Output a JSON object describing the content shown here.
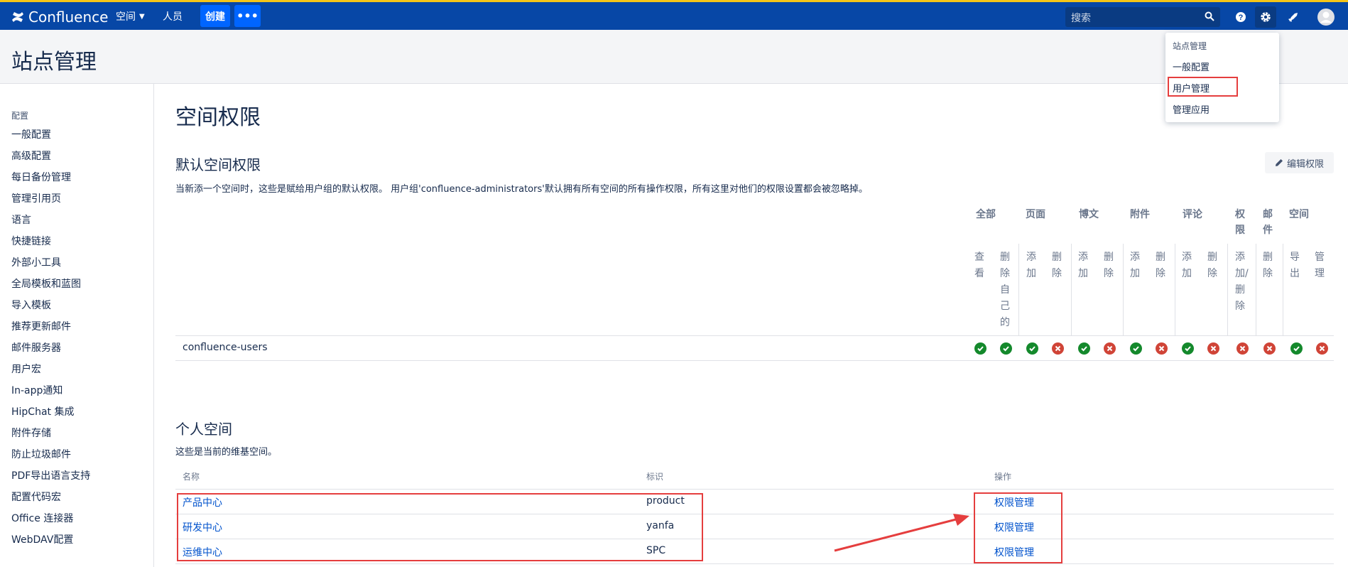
{
  "topbar": {
    "logo": "Confluence",
    "spaces": "空间",
    "people": "人员",
    "create": "创建",
    "more": "•••",
    "search_placeholder": "搜索",
    "icons": [
      "help-icon",
      "settings-icon",
      "notifications-icon",
      "avatar-icon"
    ]
  },
  "header": {
    "title": "站点管理"
  },
  "dropdown": {
    "heading": "站点管理",
    "items": [
      "一般配置",
      "用户管理",
      "管理应用"
    ]
  },
  "sidebar": {
    "heading": "配置",
    "items": [
      "一般配置",
      "高级配置",
      "每日备份管理",
      "管理引用页",
      "语言",
      "快捷链接",
      "外部小工具",
      "全局模板和蓝图",
      "导入模板",
      "推荐更新邮件",
      "邮件服务器",
      "用户宏",
      "In-app通知",
      "HipChat 集成",
      "附件存储",
      "防止垃圾邮件",
      "PDF导出语言支持",
      "配置代码宏",
      "Office 连接器",
      "WebDAV配置"
    ]
  },
  "main": {
    "title": "空间权限",
    "default_section": {
      "title": "默认空间权限",
      "description": "当新添一个空间时，这些是赋给用户组的默认权限。 用户组'confluence-administrators'默认拥有所有空间的所有操作权限，所有这里对他们的权限设置都会被忽略掉。",
      "edit_button": "编辑权限",
      "groups": [
        "全部",
        "页面",
        "博文",
        "附件",
        "评论",
        "权限",
        "邮件",
        "空间"
      ],
      "subs": [
        "查看",
        "删除自己的",
        "添加",
        "删除",
        "添加",
        "删除",
        "添加",
        "删除",
        "添加",
        "删除",
        "添加/删除",
        "删除",
        "导出",
        "管理"
      ],
      "row": {
        "name": "confluence-users",
        "values": [
          true,
          true,
          true,
          false,
          true,
          false,
          true,
          false,
          true,
          false,
          false,
          false,
          true,
          false
        ]
      }
    },
    "personal_section": {
      "title": "个人空间",
      "description": "这些是当前的维基空间。",
      "headers": {
        "name": "名称",
        "key": "标识",
        "action": "操作"
      },
      "rows": [
        {
          "name": "产品中心",
          "key": "product",
          "action": "权限管理"
        },
        {
          "name": "研发中心",
          "key": "yanfa",
          "action": "权限管理"
        },
        {
          "name": "运维中心",
          "key": "SPC",
          "action": "权限管理"
        }
      ]
    }
  },
  "colors": {
    "nav": "#0747a6",
    "accent": "#0065ff",
    "link": "#0052cc",
    "yes": "#14892c",
    "no": "#d04437",
    "annotation": "#e53e3e"
  }
}
